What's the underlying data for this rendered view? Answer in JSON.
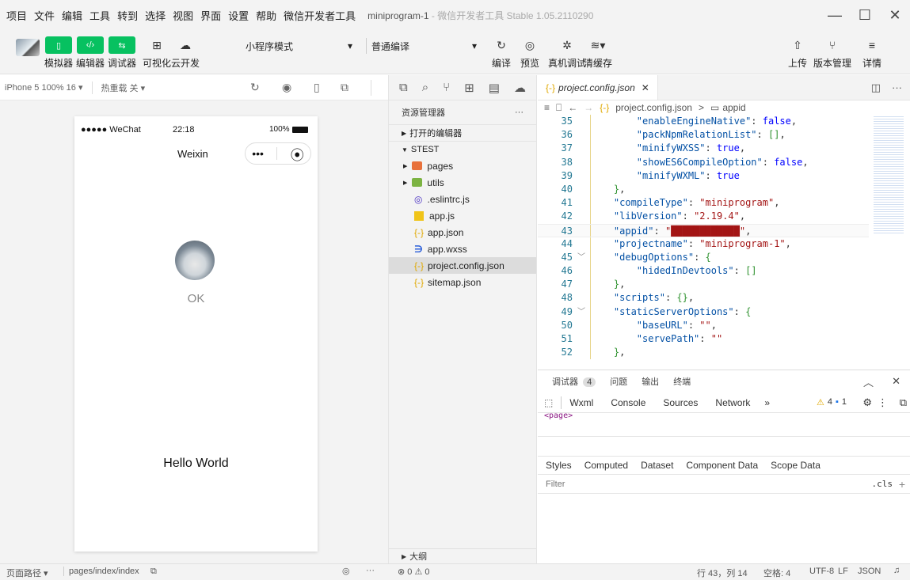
{
  "menu": {
    "items": [
      "项目",
      "文件",
      "编辑",
      "工具",
      "转到",
      "选择",
      "视图",
      "界面",
      "设置",
      "帮助",
      "微信开发者工具"
    ],
    "title_main": "miniprogram-1",
    "title_faint": " - 微信开发者工具 Stable 1.05.2110290"
  },
  "window_buttons": {
    "minimize": "—",
    "maximize": "☐",
    "close": "✕"
  },
  "toolbar": {
    "simulator": "模拟器",
    "editor": "编辑器",
    "debugger": "调试器",
    "visual": "可视化",
    "cloud": "云开发",
    "mode_select": "小程序模式",
    "compile_select": "普通编译",
    "compile": "编译",
    "preview": "预览",
    "real_debug": "真机调试",
    "clear_cache": "清缓存",
    "upload": "上传",
    "version": "版本管理",
    "details": "详情"
  },
  "simbar": {
    "device": "iPhone 5 100% 16 ▾",
    "hot_reload": "热重载 关 ▾"
  },
  "phone": {
    "signal": "●●●●● WeChat",
    "time": "22:18",
    "battery": "100%",
    "nav_title": "Weixin",
    "user_label": "OK",
    "hello": "Hello World"
  },
  "explorer": {
    "title": "资源管理器",
    "more": "···",
    "open_editors": "打开的编辑器",
    "project": "STEST",
    "files": [
      {
        "name": "pages",
        "type": "folder"
      },
      {
        "name": "utils",
        "type": "folder"
      },
      {
        "name": ".eslintrc.js",
        "type": "eslint"
      },
      {
        "name": "app.js",
        "type": "js"
      },
      {
        "name": "app.json",
        "type": "json"
      },
      {
        "name": "app.wxss",
        "type": "wxss"
      },
      {
        "name": "project.config.json",
        "type": "json"
      },
      {
        "name": "sitemap.json",
        "type": "json"
      }
    ],
    "outline": "大纲"
  },
  "editor": {
    "tab": "project.config.json",
    "breadcrumb_file": "project.config.json",
    "breadcrumb_sep": ">",
    "breadcrumb_key": "appid",
    "lines": [
      {
        "n": "35",
        "t": "        \"enableEngineNative\": false,"
      },
      {
        "n": "36",
        "t": "        \"packNpmRelationList\": [],"
      },
      {
        "n": "37",
        "t": "        \"minifyWXSS\": true,"
      },
      {
        "n": "38",
        "t": "        \"showES6CompileOption\": false,"
      },
      {
        "n": "39",
        "t": "        \"minifyWXML\": true"
      },
      {
        "n": "40",
        "t": "    },"
      },
      {
        "n": "41",
        "t": "    \"compileType\": \"miniprogram\","
      },
      {
        "n": "42",
        "t": "    \"libVersion\": \"2.19.4\","
      },
      {
        "n": "43",
        "t": "    \"appid\": \"████████████\","
      },
      {
        "n": "44",
        "t": "    \"projectname\": \"miniprogram-1\","
      },
      {
        "n": "45",
        "t": "    \"debugOptions\": {"
      },
      {
        "n": "46",
        "t": "        \"hidedInDevtools\": []"
      },
      {
        "n": "47",
        "t": "    },"
      },
      {
        "n": "48",
        "t": "    \"scripts\": {},"
      },
      {
        "n": "49",
        "t": "    \"staticServerOptions\": {"
      },
      {
        "n": "50",
        "t": "        \"baseURL\": \"\","
      },
      {
        "n": "51",
        "t": "        \"servePath\": \"\""
      },
      {
        "n": "52",
        "t": "    },"
      }
    ]
  },
  "devtools": {
    "tabs": [
      "调试器",
      "问题",
      "输出",
      "终端"
    ],
    "badge": "4",
    "panels": [
      "Wxml",
      "Console",
      "Sources",
      "Network",
      "»"
    ],
    "warn": "4",
    "info": "1",
    "style_tabs": [
      "Styles",
      "Computed",
      "Dataset",
      "Component Data",
      "Scope Data"
    ],
    "filter_placeholder": "Filter",
    "cls": ".cls",
    "plus": "+",
    "page_tag": "<page>"
  },
  "status": {
    "path_label": "页面路径 ▾",
    "path": "pages/index/index",
    "errors": "⊗ 0 ⚠ 0",
    "pos": "行 43，列 14",
    "spaces": "空格: 4",
    "encoding": "UTF-8",
    "eol": "LF",
    "lang": "JSON"
  }
}
